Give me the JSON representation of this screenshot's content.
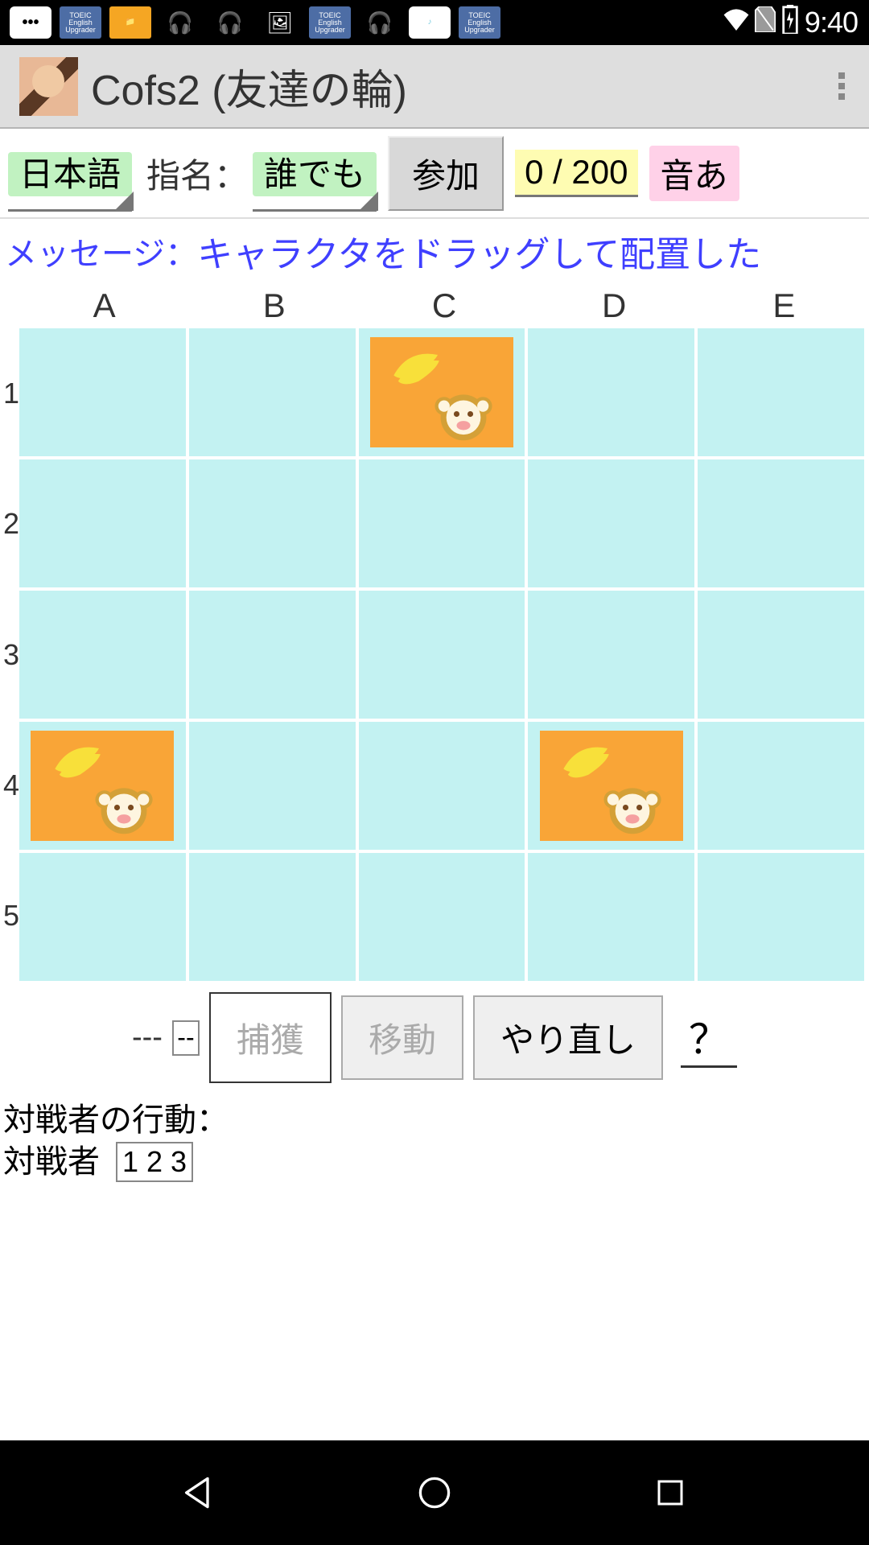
{
  "status": {
    "time": "9:40",
    "icons": {
      "sms": "sms-icon",
      "toeic1": "TOEIC",
      "folder": "folder-icon",
      "headphone1": "headphone-icon",
      "headphone2": "headphone-icon",
      "image": "image-icon",
      "toeic2": "TOEIC",
      "headphone3": "headphone-icon",
      "music": "music-icon",
      "toeic3": "TOEIC"
    }
  },
  "header": {
    "title": "Cofs2 (友達の輪)"
  },
  "controls": {
    "language": "日本語",
    "nominate_label": "指名：",
    "nominate_value": "誰でも",
    "join_label": "参加",
    "count": "0 / 200",
    "sound": "音あ"
  },
  "message": {
    "label": "メッセージ：",
    "text": "キャラクタをドラッグして配置した"
  },
  "board": {
    "columns": [
      "A",
      "B",
      "C",
      "D",
      "E"
    ],
    "rows": [
      "1",
      "2",
      "3",
      "4",
      "5"
    ],
    "pieces": [
      {
        "col": "C",
        "row": "1"
      },
      {
        "col": "A",
        "row": "4"
      },
      {
        "col": "D",
        "row": "4"
      }
    ]
  },
  "actions": {
    "dashes": "---",
    "small_box": "--",
    "capture": "捕獲",
    "move": "移動",
    "redo": "やり直し",
    "help": "？"
  },
  "bottom": {
    "opponent_action_label": "対戦者の行動：",
    "opponent_label": "対戦者",
    "opponent_value": "1 2 3"
  }
}
